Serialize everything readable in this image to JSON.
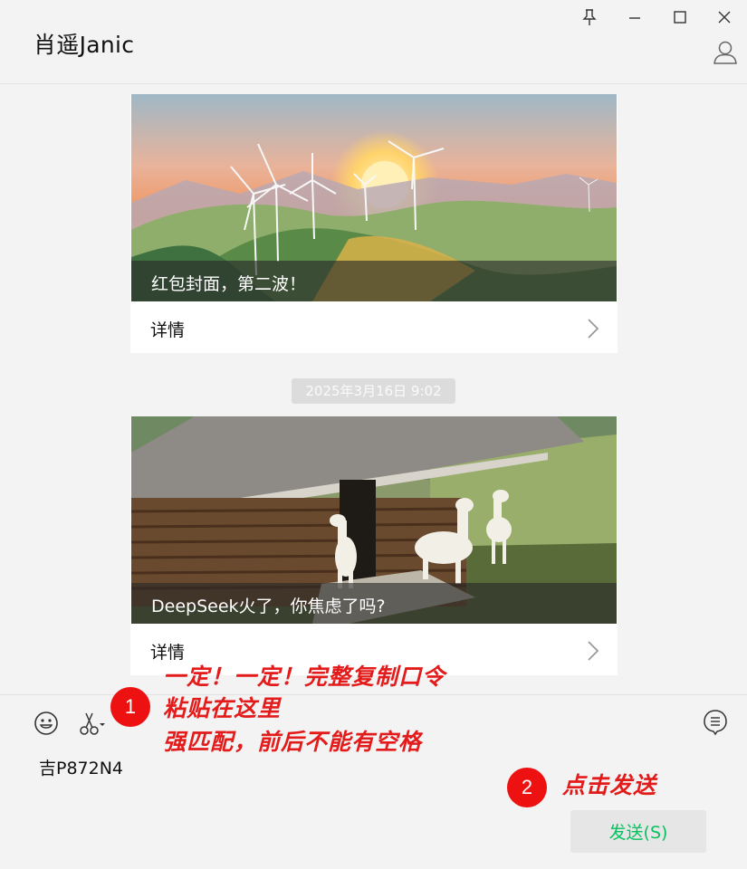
{
  "window": {
    "title": "肖遥Janic",
    "icons": [
      "pin-icon",
      "minimize-icon",
      "maximize-icon",
      "close-icon",
      "profile-icon"
    ]
  },
  "messages": [
    {
      "type": "link-card",
      "caption": "红包封面，第二波！",
      "footer_label": "详情",
      "image_icon": "wind-turbine-sunset-image"
    },
    {
      "type": "timestamp",
      "text": "2025年3月16日 9:02"
    },
    {
      "type": "link-card",
      "caption": "DeepSeek火了，你焦虑了吗?",
      "footer_label": "详情",
      "image_icon": "log-cabin-alpacas-image"
    }
  ],
  "input": {
    "tools": [
      "emoji-icon",
      "scissors-icon",
      "chat-history-icon"
    ],
    "value": "吉P872N4",
    "send_label": "发送(S)"
  },
  "annotations": {
    "step1_number": "1",
    "step1_lines": [
      "一定！一定！完整复制口令",
      "粘贴在这里",
      "强匹配，前后不能有空格"
    ],
    "step2_number": "2",
    "step2_text": "点击发送"
  },
  "colors": {
    "accent_green": "#07c160",
    "annotation_red": "#e31b1b",
    "background": "#f3f3f3"
  }
}
